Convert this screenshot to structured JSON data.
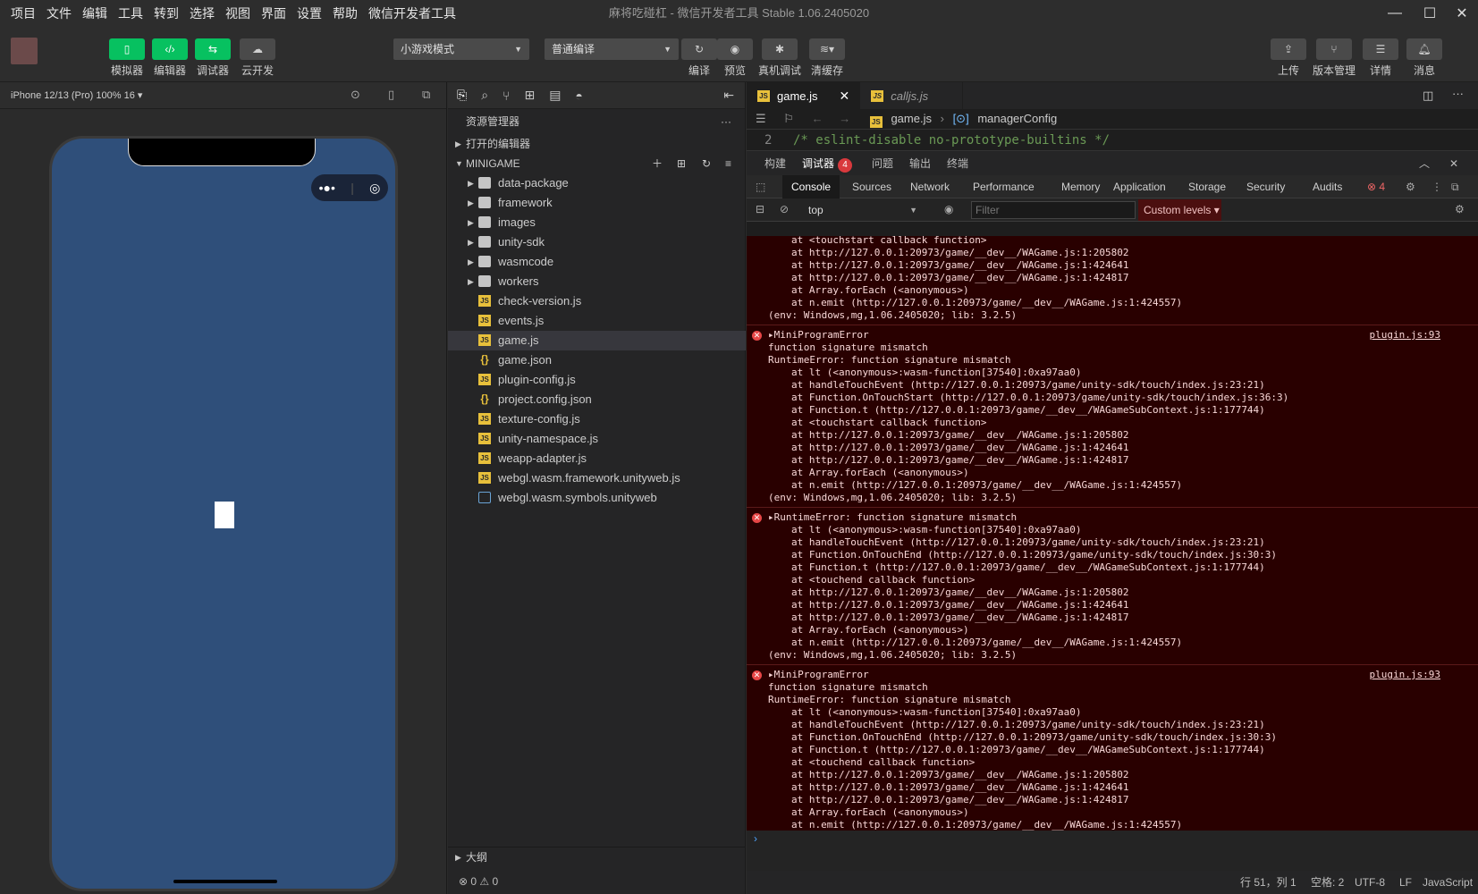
{
  "menu": [
    "项目",
    "文件",
    "编辑",
    "工具",
    "转到",
    "选择",
    "视图",
    "界面",
    "设置",
    "帮助",
    "微信开发者工具"
  ],
  "window_title": "麻将吃碰杠 - 微信开发者工具 Stable 1.06.2405020",
  "toolbar": {
    "left_buttons": [
      "模拟器",
      "编辑器",
      "调试器",
      "云开发"
    ],
    "mode_select": "小游戏模式",
    "compile_select": "普通编译",
    "mid_buttons": [
      "编译",
      "预览",
      "真机调试",
      "清缓存"
    ],
    "right_buttons": [
      "上传",
      "版本管理",
      "详情",
      "消息"
    ]
  },
  "simulator": {
    "device_label": "iPhone 12/13 (Pro) 100% 16 ▾"
  },
  "explorer": {
    "title": "资源管理器",
    "open_editors": "打开的编辑器",
    "project": "MINIGAME",
    "items": [
      {
        "name": "data-package",
        "type": "folder"
      },
      {
        "name": "framework",
        "type": "folder"
      },
      {
        "name": "images",
        "type": "folder"
      },
      {
        "name": "unity-sdk",
        "type": "folder"
      },
      {
        "name": "wasmcode",
        "type": "folder"
      },
      {
        "name": "workers",
        "type": "folder"
      },
      {
        "name": "check-version.js",
        "type": "js"
      },
      {
        "name": "events.js",
        "type": "js"
      },
      {
        "name": "game.js",
        "type": "js",
        "selected": true
      },
      {
        "name": "game.json",
        "type": "json"
      },
      {
        "name": "plugin-config.js",
        "type": "js"
      },
      {
        "name": "project.config.json",
        "type": "json"
      },
      {
        "name": "texture-config.js",
        "type": "js"
      },
      {
        "name": "unity-namespace.js",
        "type": "js"
      },
      {
        "name": "weapp-adapter.js",
        "type": "js"
      },
      {
        "name": "webgl.wasm.framework.unityweb.js",
        "type": "js"
      },
      {
        "name": "webgl.wasm.symbols.unityweb",
        "type": "file"
      }
    ],
    "outline": "大纲",
    "problems": "⊗ 0 ⚠ 0"
  },
  "editor": {
    "tabs": [
      {
        "label": "game.js",
        "active": true
      },
      {
        "label": "calljs.js",
        "active": false
      }
    ],
    "breadcrumb_file": "game.js",
    "breadcrumb_symbol": "managerConfig",
    "line_number": "2",
    "code": "/* eslint-disable no-prototype-builtins */"
  },
  "debug_panel": {
    "tabs": [
      "构建",
      "调试器",
      "问题",
      "输出",
      "终端"
    ],
    "debugger_badge": "4"
  },
  "devtools": {
    "tabs": [
      "Console",
      "Sources",
      "Network",
      "Performance",
      "Memory",
      "Application",
      "Storage",
      "Security",
      "Audits"
    ],
    "error_count": "4",
    "context": "top",
    "filter_placeholder": "Filter",
    "levels": "Custom levels ▾"
  },
  "console": {
    "top_partial": [
      "at <touchstart callback function>",
      "at http://127.0.0.1:20973/game/__dev__/WAGame.js:1:205802",
      "at http://127.0.0.1:20973/game/__dev__/WAGame.js:1:424641",
      "at http://127.0.0.1:20973/game/__dev__/WAGame.js:1:424817",
      "at Array.forEach (<anonymous>)",
      "at n.emit (http://127.0.0.1:20973/game/__dev__/WAGame.js:1:424557)",
      "(env: Windows,mg,1.06.2405020; lib: 3.2.5)"
    ],
    "entries": [
      {
        "source": "plugin.js:93",
        "header": [
          "▸MiniProgramError",
          "function signature mismatch",
          "RuntimeError: function signature mismatch"
        ],
        "stack": [
          "at lt (<anonymous>:wasm-function[37540]:0xa97aa0)",
          "at handleTouchEvent (http://127.0.0.1:20973/game/unity-sdk/touch/index.js:23:21)",
          "at Function.OnTouchStart (http://127.0.0.1:20973/game/unity-sdk/touch/index.js:36:3)",
          "at Function.t (http://127.0.0.1:20973/game/__dev__/WAGameSubContext.js:1:177744)",
          "at <touchstart callback function>",
          "at http://127.0.0.1:20973/game/__dev__/WAGame.js:1:205802",
          "at http://127.0.0.1:20973/game/__dev__/WAGame.js:1:424641",
          "at http://127.0.0.1:20973/game/__dev__/WAGame.js:1:424817",
          "at Array.forEach (<anonymous>)",
          "at n.emit (http://127.0.0.1:20973/game/__dev__/WAGame.js:1:424557)"
        ],
        "env": "(env: Windows,mg,1.06.2405020; lib: 3.2.5)"
      },
      {
        "source": "",
        "header": [
          "▸RuntimeError: function signature mismatch"
        ],
        "stack": [
          "at lt (<anonymous>:wasm-function[37540]:0xa97aa0)",
          "at handleTouchEvent (http://127.0.0.1:20973/game/unity-sdk/touch/index.js:23:21)",
          "at Function.OnTouchEnd (http://127.0.0.1:20973/game/unity-sdk/touch/index.js:30:3)",
          "at Function.t (http://127.0.0.1:20973/game/__dev__/WAGameSubContext.js:1:177744)",
          "at <touchend callback function>",
          "at http://127.0.0.1:20973/game/__dev__/WAGame.js:1:205802",
          "at http://127.0.0.1:20973/game/__dev__/WAGame.js:1:424641",
          "at http://127.0.0.1:20973/game/__dev__/WAGame.js:1:424817",
          "at Array.forEach (<anonymous>)",
          "at n.emit (http://127.0.0.1:20973/game/__dev__/WAGame.js:1:424557)"
        ],
        "env": "(env: Windows,mg,1.06.2405020; lib: 3.2.5)"
      },
      {
        "source": "plugin.js:93",
        "header": [
          "▸MiniProgramError",
          "function signature mismatch",
          "RuntimeError: function signature mismatch"
        ],
        "stack": [
          "at lt (<anonymous>:wasm-function[37540]:0xa97aa0)",
          "at handleTouchEvent (http://127.0.0.1:20973/game/unity-sdk/touch/index.js:23:21)",
          "at Function.OnTouchEnd (http://127.0.0.1:20973/game/unity-sdk/touch/index.js:30:3)",
          "at Function.t (http://127.0.0.1:20973/game/__dev__/WAGameSubContext.js:1:177744)",
          "at <touchend callback function>",
          "at http://127.0.0.1:20973/game/__dev__/WAGame.js:1:205802",
          "at http://127.0.0.1:20973/game/__dev__/WAGame.js:1:424641",
          "at http://127.0.0.1:20973/game/__dev__/WAGame.js:1:424817",
          "at Array.forEach (<anonymous>)",
          "at n.emit (http://127.0.0.1:20973/game/__dev__/WAGame.js:1:424557)"
        ],
        "env": "(env: Windows,mg,1.06.2405020; lib: 3.2.5)"
      }
    ],
    "prompt": "›"
  },
  "statusbar": {
    "position": "行 51，列 1",
    "spaces": "空格: 2",
    "encoding": "UTF-8",
    "eol": "LF",
    "language": "JavaScript"
  }
}
